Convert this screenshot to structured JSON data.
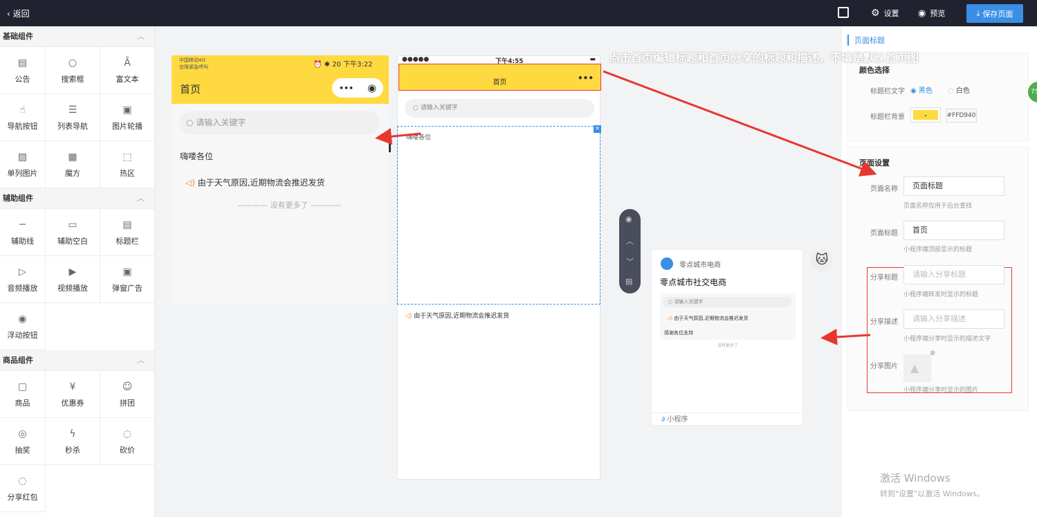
{
  "topbar": {
    "back": "返回",
    "settings": "设置",
    "preview": "预览",
    "save": "保存页面"
  },
  "groups": [
    {
      "title": "基础组件",
      "items": [
        {
          "label": "公告",
          "icon": "notice-icon"
        },
        {
          "label": "搜索框",
          "icon": "search-icon"
        },
        {
          "label": "富文本",
          "icon": "rich-text-icon"
        },
        {
          "label": "导航按钮",
          "icon": "pointer-icon"
        },
        {
          "label": "列表导航",
          "icon": "list-icon"
        },
        {
          "label": "图片轮播",
          "icon": "carousel-icon"
        },
        {
          "label": "单列图片",
          "icon": "image-icon"
        },
        {
          "label": "魔方",
          "icon": "cube-icon"
        },
        {
          "label": "热区",
          "icon": "hotspot-icon"
        }
      ]
    },
    {
      "title": "辅助组件",
      "items": [
        {
          "label": "辅助线",
          "icon": "line-icon"
        },
        {
          "label": "辅助空白",
          "icon": "blank-icon"
        },
        {
          "label": "标题栏",
          "icon": "title-bar-icon"
        },
        {
          "label": "音频播放",
          "icon": "audio-icon"
        },
        {
          "label": "视频播放",
          "icon": "video-icon"
        },
        {
          "label": "弹窗广告",
          "icon": "ad-icon"
        },
        {
          "label": "浮动按钮",
          "icon": "float-button-icon"
        }
      ]
    },
    {
      "title": "商品组件",
      "items": [
        {
          "label": "商品",
          "icon": "product-icon"
        },
        {
          "label": "优惠券",
          "icon": "coupon-icon"
        },
        {
          "label": "拼团",
          "icon": "group-buy-icon"
        },
        {
          "label": "抽奖",
          "icon": "lottery-icon"
        },
        {
          "label": "秒杀",
          "icon": "flash-sale-icon"
        },
        {
          "label": "砍价",
          "icon": "bargain-icon"
        },
        {
          "label": "分享红包",
          "icon": "red-packet-icon"
        }
      ]
    }
  ],
  "phone1": {
    "carrier": "中国移动4G",
    "carrier2": "仅限紧急呼叫",
    "status_right": "⏰ ✱ 20 下午3:22",
    "title": "首页",
    "search_placeholder": "请输入关键字",
    "greeting": "嗨喽各位",
    "notice": "由于天气原因,近期物流会推迟发货",
    "no_more": "没有更多了"
  },
  "phone2": {
    "signal": "●●●●●",
    "time": "下午4:55",
    "title": "首页",
    "dots": "•••",
    "search_placeholder": "请输入关键字",
    "block_text": "嗨喽各位",
    "notice": "由于天气原因,近期物流会推迟发货"
  },
  "share_card": {
    "app_name": "零点城市电商",
    "title": "零点城市社交电商",
    "search_placeholder": "请输入关键字",
    "notice": "由于天气原因,近期物流会推迟发货",
    "thanks": "感谢各位支持",
    "no_more": "没有更多了",
    "footer": "小程序"
  },
  "annotation": "点击首页编辑标题和首页分享的标题和描述，不填是默认首页图",
  "panel": {
    "tab": "页面标题",
    "color_section": "颜色选择",
    "title_text_label": "标题栏文字",
    "opt_black": "黑色",
    "opt_white": "白色",
    "title_bg_label": "标题栏背景",
    "bg_value": "#FFD940",
    "page_section": "页面设置",
    "name_label": "页面名称",
    "name_value": "页面标题",
    "name_hint": "页面名称仅用于后台查找",
    "ptitle_label": "页面标题",
    "ptitle_value": "首页",
    "ptitle_hint": "小程序端顶部显示的标题",
    "share_title_label": "分享标题",
    "share_title_ph": "请输入分享标题",
    "share_title_hint": "小程序端转发时显示的标题",
    "share_desc_label": "分享描述",
    "share_desc_ph": "请输入分享描述",
    "share_desc_hint": "小程序端分享时显示的描述文字",
    "share_img_label": "分享图片",
    "share_img_hint": "小程序端分享时显示的图片"
  },
  "watermark": {
    "line1": "激活 Windows",
    "line2": "转到\"设置\"以激活 Windows。"
  },
  "badge": "75",
  "colors": {
    "accent": "#3a8ee6",
    "yellow": "#ffd940",
    "red": "#e8372f",
    "dark": "#202230"
  }
}
